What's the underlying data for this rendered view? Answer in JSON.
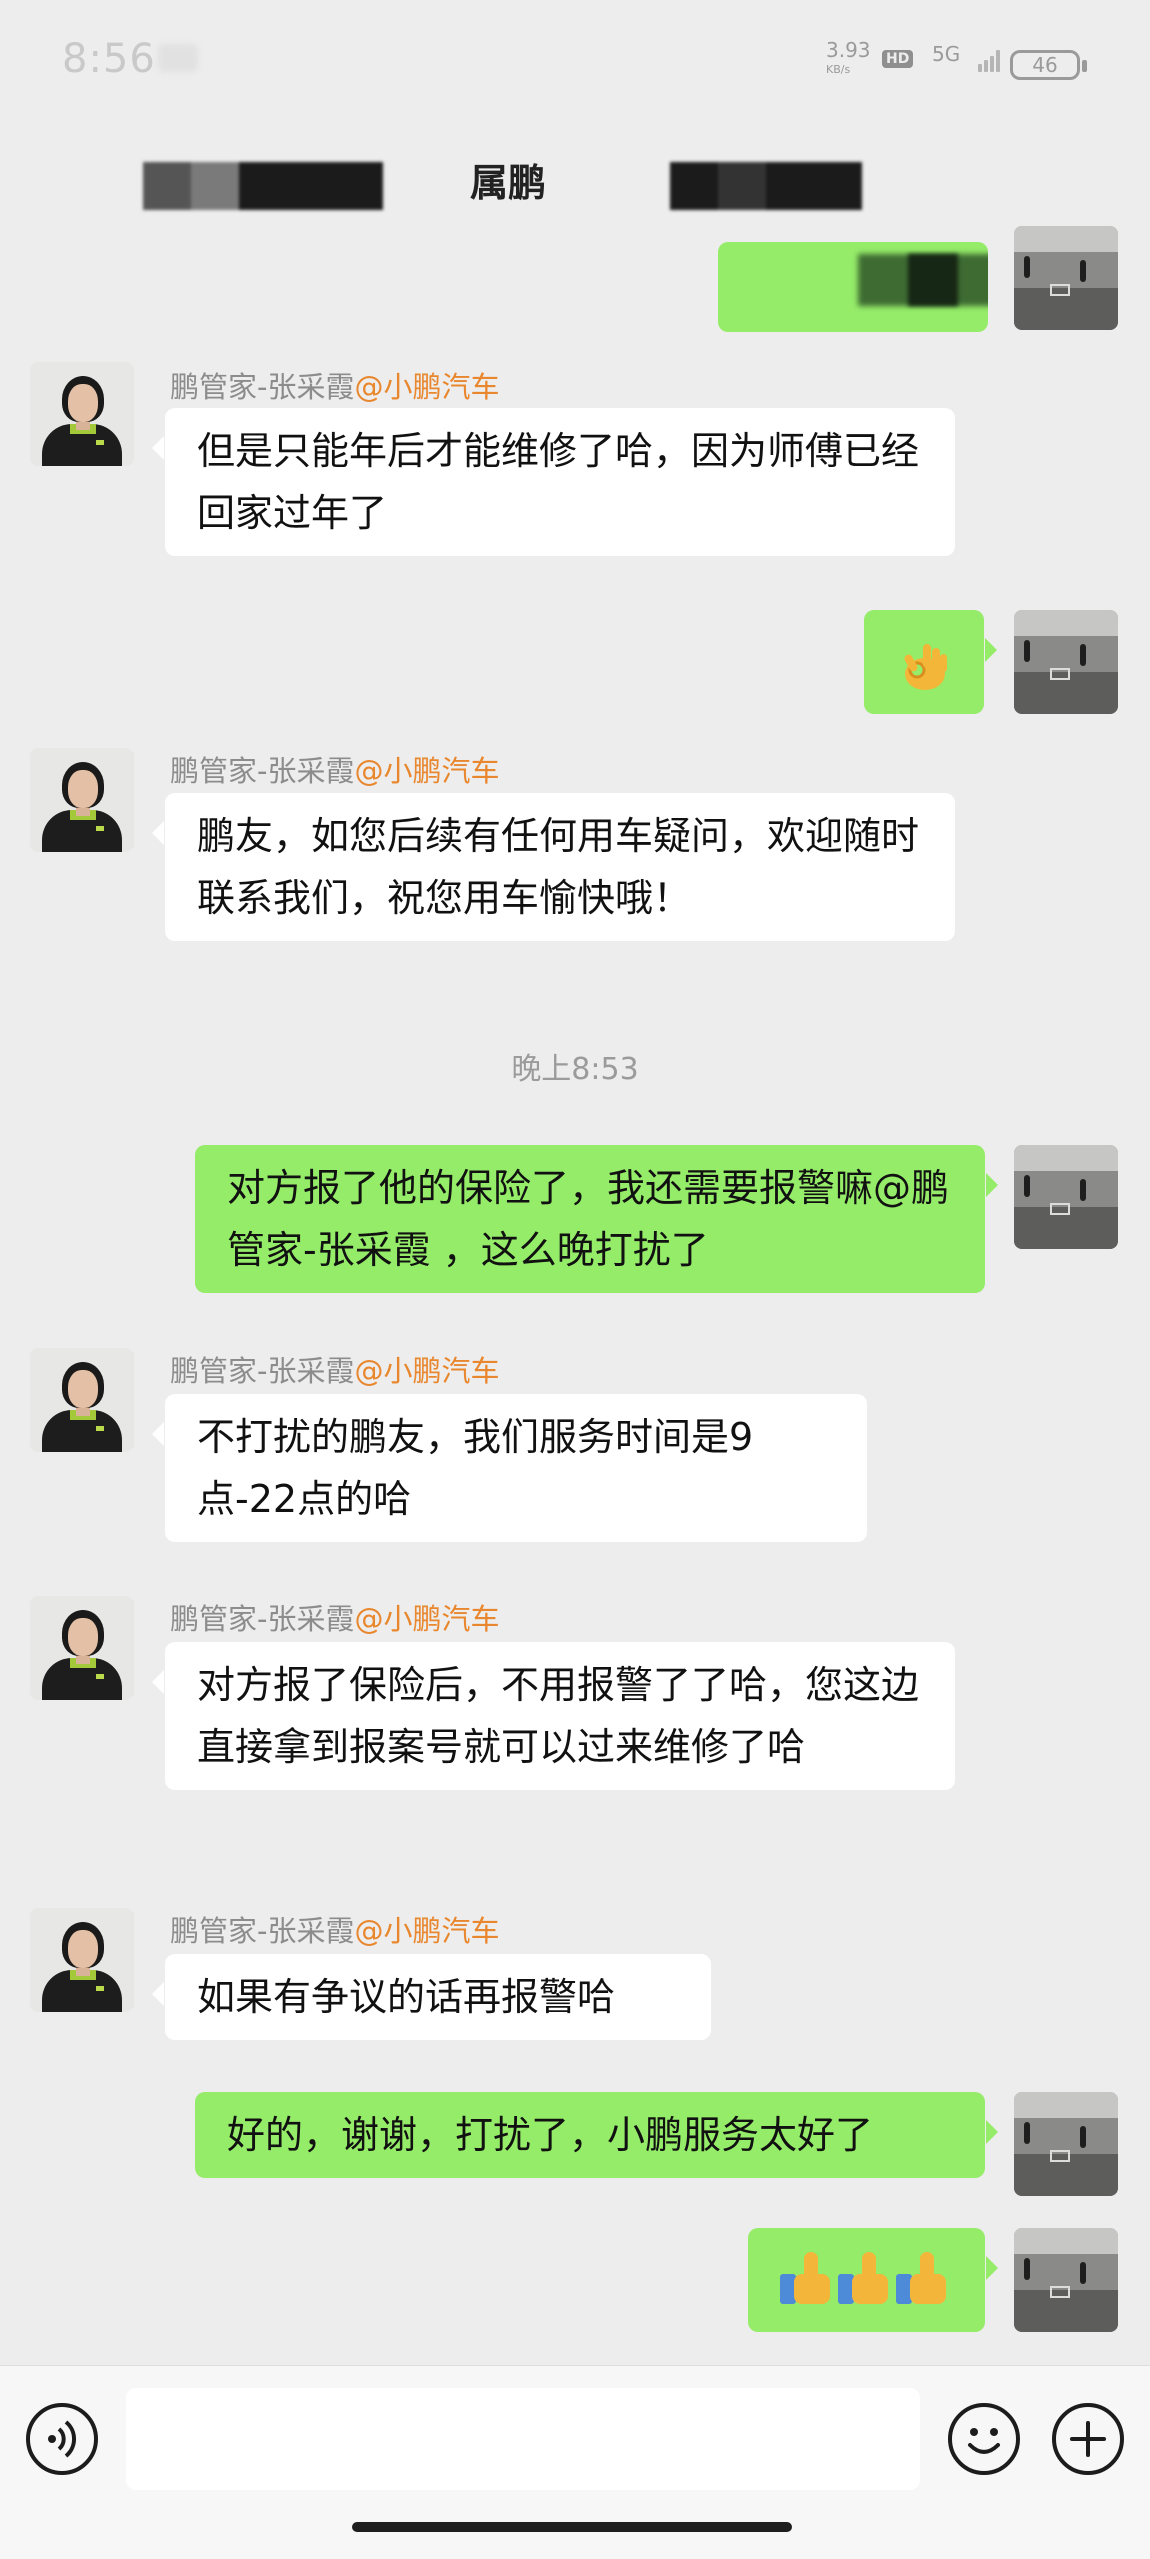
{
  "status_bar": {
    "time": "8:56",
    "net_speed": "3.93",
    "net_unit": "KB/s",
    "hd_label": "HD",
    "network": "5G",
    "battery": "46"
  },
  "header": {
    "title": "属鹏"
  },
  "messages": [
    {
      "id": "m1",
      "sender": "鹏管家-张采霞",
      "sender_org": "@小鹏汽车",
      "text": "但是只能年后才能维修了哈，因为师傅已经回家过年了"
    },
    {
      "id": "m2",
      "emoji": "ok-hand"
    },
    {
      "id": "m3",
      "sender": "鹏管家-张采霞",
      "sender_org": "@小鹏汽车",
      "text": "鹏友，如您后续有任何用车疑问，欢迎随时联系我们，祝您用车愉快哦！"
    },
    {
      "id": "m4",
      "text": "对方报了他的保险了，我还需要报警嘛@鹏管家-张采霞 ，这么晚打扰了"
    },
    {
      "id": "m5",
      "sender": "鹏管家-张采霞",
      "sender_org": "@小鹏汽车",
      "text": "不打扰的鹏友，我们服务时间是9点-22点的哈"
    },
    {
      "id": "m6",
      "sender": "鹏管家-张采霞",
      "sender_org": "@小鹏汽车",
      "text": "对方报了保险后，不用报警了了哈，您这边直接拿到报案号就可以过来维修了哈"
    },
    {
      "id": "m7",
      "sender": "鹏管家-张采霞",
      "sender_org": "@小鹏汽车",
      "text": "如果有争议的话再报警哈"
    },
    {
      "id": "m8",
      "text": "好的，谢谢，打扰了，小鹏服务太好了"
    },
    {
      "id": "m9",
      "emoji": "thumbs-up x3"
    }
  ],
  "timestamp": "晚上8:53",
  "input": {
    "placeholder": "",
    "voice_icon": "voice-icon",
    "emoji_icon": "smiley-icon",
    "plus_icon": "plus-icon"
  },
  "colors": {
    "background": "#ededed",
    "incoming_bubble": "#ffffff",
    "outgoing_bubble": "#95ec69",
    "sender_org": "#e9872e"
  }
}
